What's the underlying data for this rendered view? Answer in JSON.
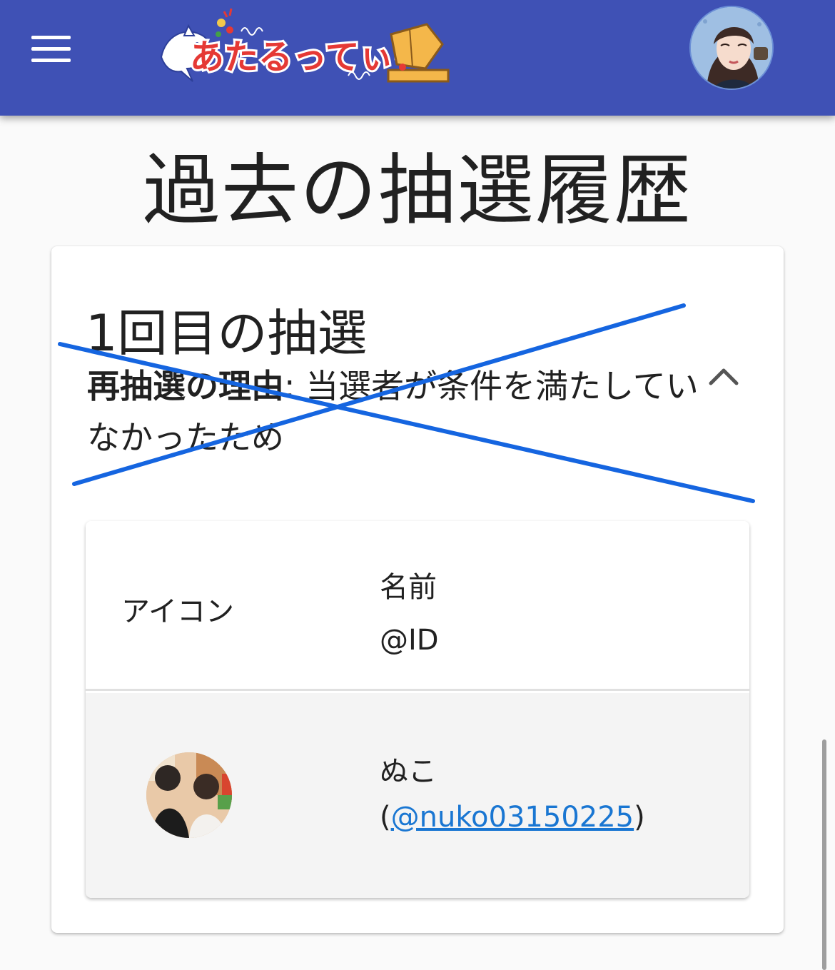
{
  "header": {
    "logo_text": "あたるってぃー",
    "menu_icon": "hamburger-menu-icon",
    "profile_icon": "user-avatar",
    "bar_color": "#3f51b5"
  },
  "page": {
    "title": "過去の抽選履歴"
  },
  "draw_card": {
    "round_title": "1回目の抽選",
    "reason_label": "再抽選の理由",
    "reason_separator": ": ",
    "reason_text": "当選者が条件を満たしていなかったため",
    "toggle_icon": "chevron-up-icon",
    "cross_out_color": "#1565e0"
  },
  "winners_table": {
    "headers": {
      "icon": "アイコン",
      "name": "名前",
      "id": "@ID"
    },
    "rows": [
      {
        "name": "ぬこ",
        "open_paren": "(",
        "handle": "@nuko03150225",
        "close_paren": ")"
      }
    ],
    "link_color": "#1976d2"
  }
}
